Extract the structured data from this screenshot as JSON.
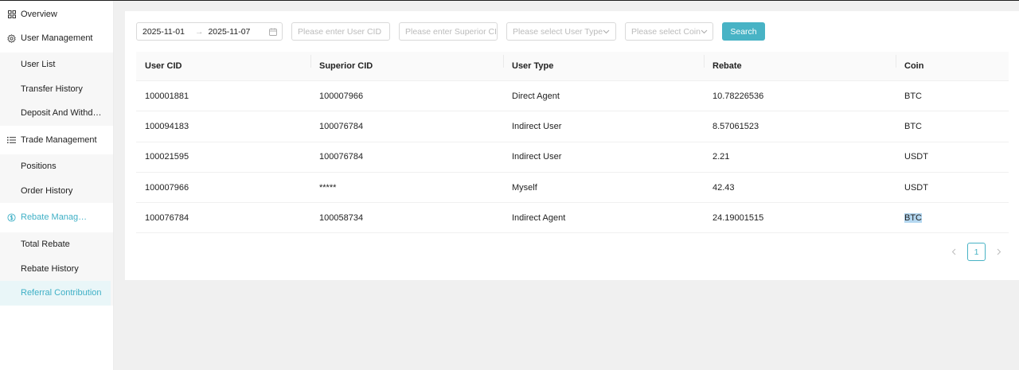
{
  "sidebar": {
    "overview": "Overview",
    "user_management": "User Management",
    "user_items": [
      "User List",
      "Transfer History",
      "Deposit And Withdrawal"
    ],
    "trade_management": "Trade Management",
    "trade_items": [
      "Positions",
      "Order History"
    ],
    "rebate_management": "Rebate Management",
    "rebate_items": [
      "Total Rebate",
      "Rebate History",
      "Referral Contribution"
    ],
    "active_color": "#3fb0c6"
  },
  "filters": {
    "date_start": "2025-11-01",
    "date_end": "2025-11-07",
    "user_cid_placeholder": "Please enter User CID",
    "superior_cid_placeholder": "Please enter Superior CID",
    "user_type_placeholder": "Please select User Type",
    "coin_placeholder": "Please select Coin",
    "search_label": "Search",
    "accent_color": "#48b3c5"
  },
  "table": {
    "headers": [
      "User CID",
      "Superior CID",
      "User Type",
      "Rebate",
      "Coin"
    ],
    "rows": [
      [
        "100001881",
        "100007966",
        "Direct Agent",
        "10.78226536",
        "BTC"
      ],
      [
        "100094183",
        "100076784",
        "Indirect User",
        "8.57061523",
        "BTC"
      ],
      [
        "100021595",
        "100076784",
        "Indirect User",
        "2.21",
        "USDT"
      ],
      [
        "100007966",
        "*****",
        "Myself",
        "42.43",
        "USDT"
      ],
      [
        "100076784",
        "100058734",
        "Indirect Agent",
        "24.19001515",
        "BTC"
      ]
    ]
  },
  "pagination": {
    "current_page": "1",
    "prev_icon": "chevron-left-icon",
    "next_icon": "chevron-right-icon"
  }
}
